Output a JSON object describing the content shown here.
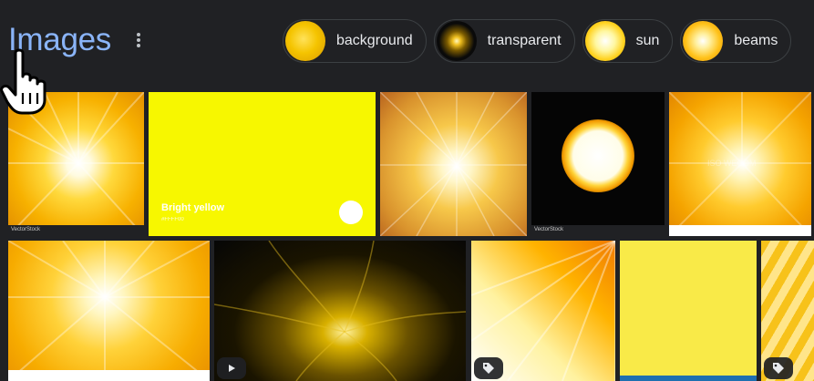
{
  "header": {
    "title": "Images",
    "more_icon": "more-vert-icon"
  },
  "chips": [
    {
      "label": "background",
      "thumb_color": "#f5c400"
    },
    {
      "label": "transparent",
      "thumb_color": "#0a0a0a"
    },
    {
      "label": "sun",
      "thumb_color": "#ffd21f"
    },
    {
      "label": "beams",
      "thumb_color": "#ffc21a"
    }
  ],
  "tiles": [
    {
      "caption": "VectorStock",
      "dominant_color": "#f7b100"
    },
    {
      "swatch_title": "Bright yellow",
      "swatch_hex": "#FFFF00",
      "dominant_color": "#f7f700"
    },
    {
      "dominant_color": "#d9932d"
    },
    {
      "caption": "VectorStock",
      "dominant_color": "#050505"
    },
    {
      "watermark": "ISO WECOM",
      "dominant_color": "#f5a400"
    },
    {
      "dominant_color": "#f7ac00"
    },
    {
      "badge_icon": "play-icon",
      "dominant_color": "#060606"
    },
    {
      "badge_icon": "tag-icon",
      "dominant_color": "#ffb300"
    },
    {
      "dominant_color": "#f9ea48"
    },
    {
      "badge_icon": "tag-icon",
      "dominant_color": "#f7c21a"
    }
  ],
  "colors": {
    "background": "#202124",
    "title": "#8ab4f8",
    "chip_text": "#e8eaed",
    "chip_border": "#3c4043"
  },
  "cursor_icon": "hand-pointer-icon"
}
